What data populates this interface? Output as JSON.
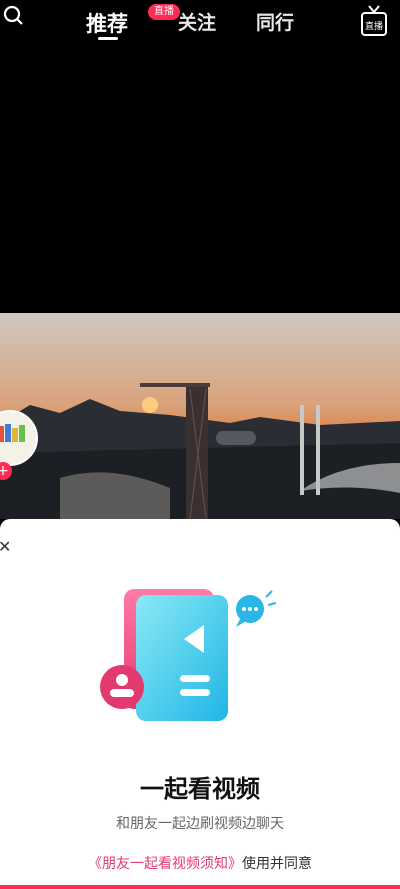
{
  "topbar": {
    "tabs": [
      {
        "label": "推荐",
        "active": true
      },
      {
        "label": "关注",
        "active": false
      },
      {
        "label": "同行",
        "active": false
      }
    ],
    "live_badge": "直播",
    "live_icon_label": "直播"
  },
  "sheet": {
    "title": "一起看视频",
    "subtitle": "和朋友一起边刷视频边聊天",
    "agree_prefix": "使用并同意",
    "agree_link": "《朋友一起看视频须知》"
  },
  "colors": {
    "accent": "#fe2c55",
    "link": "#e33b6f"
  },
  "icons": [
    "search-icon",
    "live-icon",
    "close-icon",
    "plus-icon",
    "chat-bubble-icon",
    "users-icon",
    "play-icon"
  ]
}
